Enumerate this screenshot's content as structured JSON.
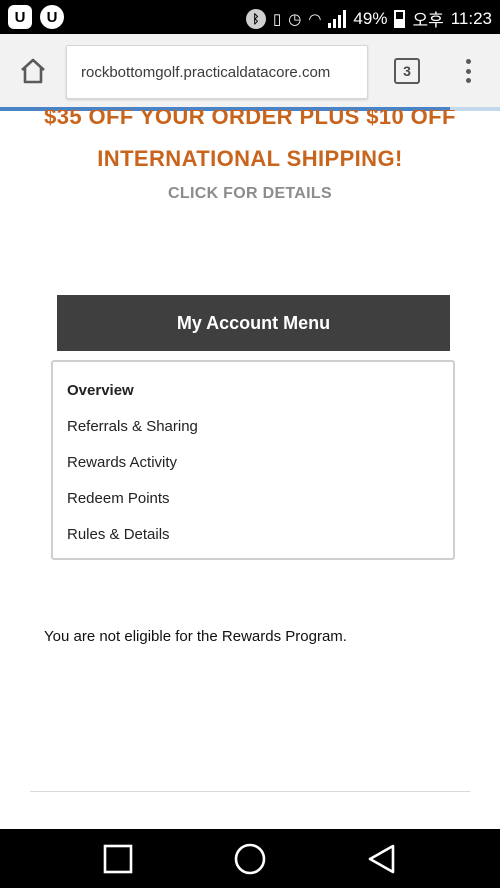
{
  "status_bar": {
    "app_icons": [
      "U",
      "U"
    ],
    "battery": "49%",
    "carrier": "오후",
    "time": "11:23"
  },
  "browser": {
    "url": "rockbottomgolf.practicaldatacore.com",
    "tab_count": "3",
    "load_progress": 0.9
  },
  "promo": {
    "line1": "$35 OFF YOUR ORDER PLUS $10 OFF",
    "line2": "INTERNATIONAL SHIPPING!",
    "link": "CLICK FOR DETAILS",
    "color": "#c8641c"
  },
  "account_menu": {
    "title": "My Account Menu",
    "items": [
      {
        "label": "Overview",
        "active": true
      },
      {
        "label": "Referrals & Sharing",
        "active": false
      },
      {
        "label": "Rewards Activity",
        "active": false
      },
      {
        "label": "Redeem Points",
        "active": false
      },
      {
        "label": "Rules & Details",
        "active": false
      }
    ]
  },
  "message": "You are not eligible for the Rewards Program."
}
